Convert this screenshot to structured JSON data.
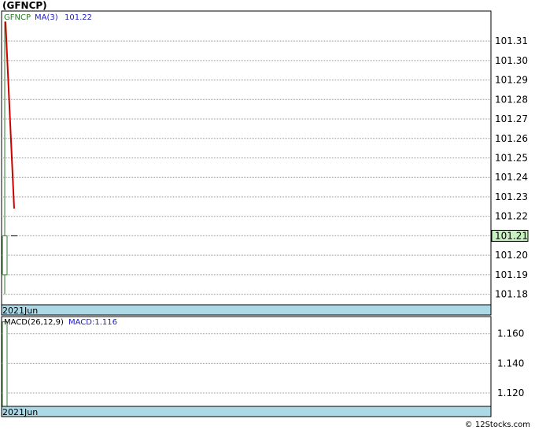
{
  "title": "(GFNCP)",
  "footer": "© 12Stocks.com",
  "colors": {
    "ma": "#cc0000",
    "candle": "#2e7d2e",
    "price_badge_bg": "#c8f0c0",
    "date_strip": "#add8e6",
    "grid": "#999999",
    "legend_ticker": "#2a7a2a",
    "legend_ma": "#1a1acc"
  },
  "chart_data": [
    {
      "type": "line",
      "ticker": "GFNCP",
      "ma_label": "MA(3)",
      "ma_value": "101.22",
      "last_price": "101.21",
      "date_label": "2021Jun",
      "ylim": [
        101.175,
        101.325
      ],
      "yticks": [
        "101.31",
        "101.30",
        "101.29",
        "101.28",
        "101.27",
        "101.26",
        "101.25",
        "101.24",
        "101.23",
        "101.22",
        "101.21",
        "101.20",
        "101.19",
        "101.18"
      ],
      "candle": {
        "open": 101.21,
        "close": 101.19,
        "high": 101.32,
        "low": 101.18
      },
      "close_tick": 101.21,
      "ma_line": [
        101.32,
        101.224
      ]
    },
    {
      "type": "line",
      "indicator_label": "MACD(26,12,9)",
      "value_label": "MACD:1.116",
      "date_label": "2021Jun",
      "ylim": [
        1.111,
        1.171
      ],
      "yticks": [
        "1.160",
        "1.140",
        "1.120"
      ],
      "bar": {
        "from": 1.168,
        "to": 1.111
      }
    }
  ]
}
